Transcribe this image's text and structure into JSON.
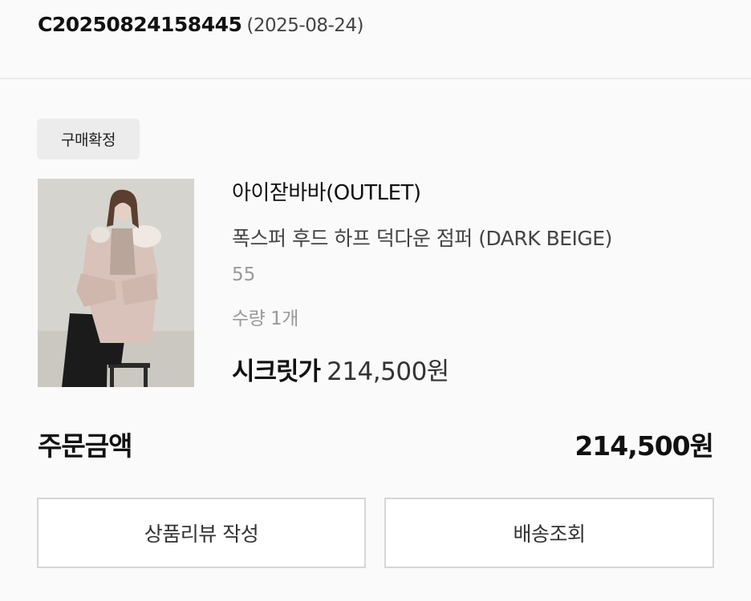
{
  "order": {
    "number": "C20250824158445",
    "date": "(2025-08-24)"
  },
  "status": {
    "label": "구매확정"
  },
  "product": {
    "image_alt": "폭스퍼 후드 하프 덕다운 점퍼 상품 이미지",
    "brand": "아이잗바바(OUTLET)",
    "name": "폭스퍼 후드 하프 덕다운 점퍼 (DARK BEIGE)",
    "option": "55",
    "quantity": "수량 1개",
    "price_label": "시크릿가",
    "price_value": "214,500원"
  },
  "summary": {
    "total_label": "주문금액",
    "total_value": "214,500원"
  },
  "actions": {
    "review_label": "상품리뷰 작성",
    "shipping_label": "배송조회"
  },
  "colors": {
    "background": "#fafafa",
    "badge_bg": "#ececec",
    "border": "#d6d6d6"
  }
}
